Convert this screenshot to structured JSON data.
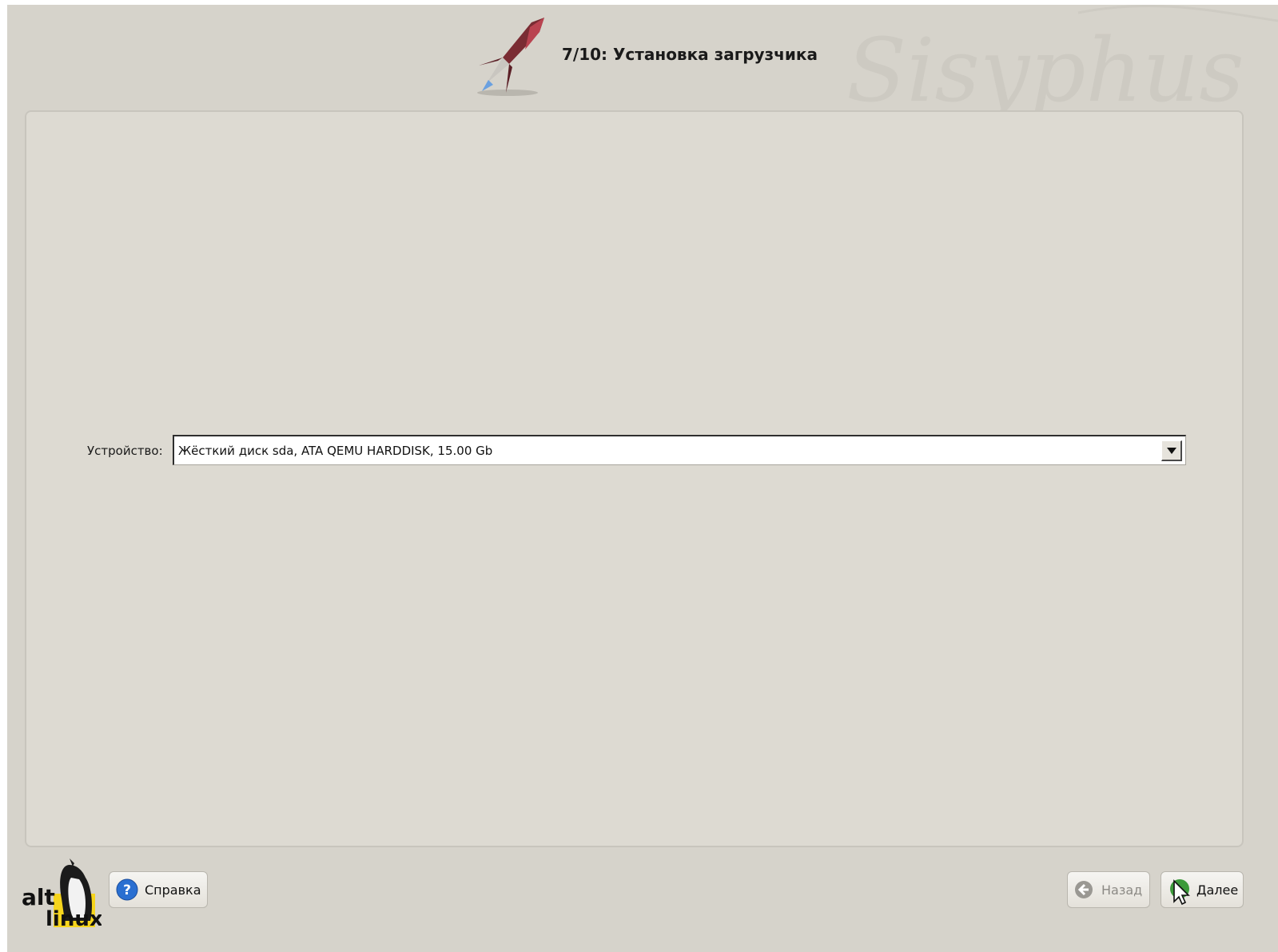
{
  "header": {
    "step_title": "7/10: Установка загрузчика",
    "watermark": "Sisyphus"
  },
  "main": {
    "device_label": "Устройство:",
    "device_value": "Жёсткий диск sda, ATA QEMU HARDDISK, 15.00 Gb"
  },
  "footer": {
    "logo_text_top": "alt",
    "logo_text_bottom": "linux",
    "help_label": "Справка",
    "back_label": "Назад",
    "next_label": "Далее"
  },
  "icons": {
    "header": "rocket-icon",
    "help": "help-icon",
    "back": "arrow-left-icon",
    "next": "cursor-icon",
    "dropdown": "chevron-down-icon"
  },
  "colors": {
    "window_bg": "#d6d3cb",
    "panel_bg": "#dddad2",
    "help_blue": "#2a6fd1",
    "logo_yellow": "#f6d51d"
  }
}
